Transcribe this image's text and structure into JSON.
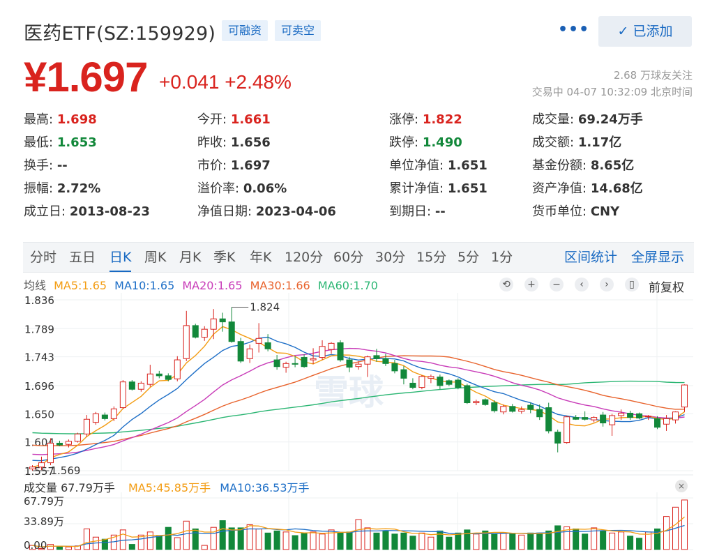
{
  "header": {
    "title": "医药ETF(SZ:159929)",
    "tag_margin": "可融资",
    "tag_short": "可卖空",
    "more": "•••",
    "added_label": "已添加",
    "price": "¥1.697",
    "change": "+0.041 +2.48%",
    "followers": "2.68 万球友关注",
    "status": "交易中 04-07 10:32:09 北京时间"
  },
  "stats": {
    "high_label": "最高:",
    "high": "1.698",
    "low_label": "最低:",
    "low": "1.653",
    "turnover_label": "换手:",
    "turnover": "--",
    "amplitude_label": "振幅:",
    "amplitude": "2.72%",
    "found_label": "成立日:",
    "found": "2013-08-23",
    "open_label": "今开:",
    "open": "1.661",
    "prev_label": "昨收:",
    "prev": "1.656",
    "mktprice_label": "市价:",
    "mktprice": "1.697",
    "premium_label": "溢价率:",
    "premium": "0.06%",
    "navdate_label": "净值日期:",
    "navdate": "2023-04-06",
    "limitup_label": "涨停:",
    "limitup": "1.822",
    "limitdown_label": "跌停:",
    "limitdown": "1.490",
    "unitnav_label": "单位净值:",
    "unitnav": "1.651",
    "cumnav_label": "累计净值:",
    "cumnav": "1.651",
    "expire_label": "到期日:",
    "expire": "--",
    "volume_label": "成交量:",
    "volume": "69.24万手",
    "amount_label": "成交额:",
    "amount": "1.17亿",
    "shares_label": "基金份额:",
    "shares": "8.65亿",
    "assets_label": "资产净值:",
    "assets": "14.68亿",
    "currency_label": "货币单位:",
    "currency": "CNY"
  },
  "tabs": [
    "分时",
    "五日",
    "日K",
    "周K",
    "月K",
    "季K",
    "年K",
    "120分",
    "60分",
    "30分",
    "15分",
    "5分",
    "1分"
  ],
  "tabs_active": 2,
  "tabs_right": [
    "区间统计",
    "全屏显示"
  ],
  "ma": {
    "avg": "均线",
    "ma5": "MA5:1.65",
    "ma10": "MA10:1.65",
    "ma20": "MA20:1.65",
    "ma30": "MA30:1.66",
    "ma60": "MA60:1.70",
    "fq": "前复权"
  },
  "controls": [
    "⟲",
    "+",
    "−",
    "‹",
    "›",
    "▯"
  ],
  "watermark": "雪球",
  "colors": {
    "up": "#d9231e",
    "down": "#12883a",
    "ma5": "#f39c12",
    "ma10": "#1e6fc7",
    "ma20": "#c83bb8",
    "ma30": "#e8622b",
    "ma60": "#2bb673",
    "accent": "#1869c2"
  },
  "volume": {
    "header": "成交量 67.79万手",
    "ma5": "MA5:45.85万手",
    "ma10": "MA10:36.53万手",
    "ticks": [
      "67.79万",
      "33.89万",
      "0.00"
    ],
    "close": "×"
  },
  "chart_data": {
    "type": "candlestick",
    "yticks": [
      "1.836",
      "1.789",
      "1.743",
      "1.696",
      "1.650",
      "1.604",
      "1.557"
    ],
    "ylim": [
      1.557,
      1.836
    ],
    "max_label": "1.824",
    "min_label": "1.569",
    "candles": [
      {
        "o": 1.56,
        "h": 1.566,
        "l": 1.557,
        "c": 1.563
      },
      {
        "o": 1.563,
        "h": 1.58,
        "l": 1.558,
        "c": 1.57
      },
      {
        "o": 1.57,
        "h": 1.61,
        "l": 1.566,
        "c": 1.602
      },
      {
        "o": 1.602,
        "h": 1.606,
        "l": 1.597,
        "c": 1.599
      },
      {
        "o": 1.6,
        "h": 1.608,
        "l": 1.595,
        "c": 1.605
      },
      {
        "o": 1.605,
        "h": 1.619,
        "l": 1.603,
        "c": 1.617
      },
      {
        "o": 1.617,
        "h": 1.648,
        "l": 1.612,
        "c": 1.641
      },
      {
        "o": 1.636,
        "h": 1.653,
        "l": 1.632,
        "c": 1.65
      },
      {
        "o": 1.648,
        "h": 1.652,
        "l": 1.639,
        "c": 1.642
      },
      {
        "o": 1.642,
        "h": 1.662,
        "l": 1.638,
        "c": 1.658
      },
      {
        "o": 1.66,
        "h": 1.705,
        "l": 1.658,
        "c": 1.702
      },
      {
        "o": 1.702,
        "h": 1.705,
        "l": 1.688,
        "c": 1.69
      },
      {
        "o": 1.69,
        "h": 1.703,
        "l": 1.686,
        "c": 1.7
      },
      {
        "o": 1.698,
        "h": 1.73,
        "l": 1.694,
        "c": 1.715
      },
      {
        "o": 1.715,
        "h": 1.72,
        "l": 1.708,
        "c": 1.712
      },
      {
        "o": 1.712,
        "h": 1.716,
        "l": 1.703,
        "c": 1.706
      },
      {
        "o": 1.707,
        "h": 1.744,
        "l": 1.703,
        "c": 1.738
      },
      {
        "o": 1.74,
        "h": 1.818,
        "l": 1.736,
        "c": 1.794
      },
      {
        "o": 1.794,
        "h": 1.797,
        "l": 1.773,
        "c": 1.775
      },
      {
        "o": 1.775,
        "h": 1.793,
        "l": 1.769,
        "c": 1.788
      },
      {
        "o": 1.788,
        "h": 1.821,
        "l": 1.772,
        "c": 1.805
      },
      {
        "o": 1.805,
        "h": 1.815,
        "l": 1.784,
        "c": 1.8
      },
      {
        "o": 1.8,
        "h": 1.824,
        "l": 1.766,
        "c": 1.768
      },
      {
        "o": 1.768,
        "h": 1.774,
        "l": 1.733,
        "c": 1.736
      },
      {
        "o": 1.74,
        "h": 1.763,
        "l": 1.733,
        "c": 1.756
      },
      {
        "o": 1.765,
        "h": 1.798,
        "l": 1.75,
        "c": 1.773
      },
      {
        "o": 1.766,
        "h": 1.78,
        "l": 1.752,
        "c": 1.756
      },
      {
        "o": 1.738,
        "h": 1.746,
        "l": 1.722,
        "c": 1.727
      },
      {
        "o": 1.726,
        "h": 1.735,
        "l": 1.717,
        "c": 1.732
      },
      {
        "o": 1.732,
        "h": 1.744,
        "l": 1.726,
        "c": 1.731
      },
      {
        "o": 1.742,
        "h": 1.747,
        "l": 1.725,
        "c": 1.727
      },
      {
        "o": 1.738,
        "h": 1.757,
        "l": 1.731,
        "c": 1.74
      },
      {
        "o": 1.742,
        "h": 1.77,
        "l": 1.738,
        "c": 1.76
      },
      {
        "o": 1.755,
        "h": 1.767,
        "l": 1.748,
        "c": 1.765
      },
      {
        "o": 1.766,
        "h": 1.77,
        "l": 1.735,
        "c": 1.738
      },
      {
        "o": 1.738,
        "h": 1.743,
        "l": 1.718,
        "c": 1.726
      },
      {
        "o": 1.727,
        "h": 1.736,
        "l": 1.722,
        "c": 1.731
      },
      {
        "o": 1.731,
        "h": 1.745,
        "l": 1.71,
        "c": 1.743
      },
      {
        "o": 1.745,
        "h": 1.756,
        "l": 1.735,
        "c": 1.74
      },
      {
        "o": 1.74,
        "h": 1.748,
        "l": 1.728,
        "c": 1.732
      },
      {
        "o": 1.732,
        "h": 1.738,
        "l": 1.716,
        "c": 1.72
      },
      {
        "o": 1.722,
        "h": 1.728,
        "l": 1.698,
        "c": 1.708
      },
      {
        "o": 1.7,
        "h": 1.708,
        "l": 1.69,
        "c": 1.693
      },
      {
        "o": 1.693,
        "h": 1.713,
        "l": 1.69,
        "c": 1.711
      },
      {
        "o": 1.708,
        "h": 1.714,
        "l": 1.7,
        "c": 1.711
      },
      {
        "o": 1.71,
        "h": 1.714,
        "l": 1.69,
        "c": 1.696
      },
      {
        "o": 1.704,
        "h": 1.706,
        "l": 1.695,
        "c": 1.698
      },
      {
        "o": 1.705,
        "h": 1.708,
        "l": 1.69,
        "c": 1.693
      },
      {
        "o": 1.696,
        "h": 1.699,
        "l": 1.666,
        "c": 1.668
      },
      {
        "o": 1.668,
        "h": 1.673,
        "l": 1.664,
        "c": 1.67
      },
      {
        "o": 1.673,
        "h": 1.675,
        "l": 1.663,
        "c": 1.665
      },
      {
        "o": 1.668,
        "h": 1.672,
        "l": 1.652,
        "c": 1.655
      },
      {
        "o": 1.653,
        "h": 1.665,
        "l": 1.649,
        "c": 1.662
      },
      {
        "o": 1.662,
        "h": 1.666,
        "l": 1.652,
        "c": 1.654
      },
      {
        "o": 1.654,
        "h": 1.662,
        "l": 1.65,
        "c": 1.657
      },
      {
        "o": 1.664,
        "h": 1.668,
        "l": 1.651,
        "c": 1.657
      },
      {
        "o": 1.657,
        "h": 1.665,
        "l": 1.64,
        "c": 1.645
      },
      {
        "o": 1.66,
        "h": 1.668,
        "l": 1.618,
        "c": 1.622
      },
      {
        "o": 1.62,
        "h": 1.624,
        "l": 1.587,
        "c": 1.602
      },
      {
        "o": 1.603,
        "h": 1.647,
        "l": 1.601,
        "c": 1.645
      },
      {
        "o": 1.644,
        "h": 1.648,
        "l": 1.64,
        "c": 1.641
      },
      {
        "o": 1.644,
        "h": 1.654,
        "l": 1.639,
        "c": 1.641
      },
      {
        "o": 1.64,
        "h": 1.646,
        "l": 1.636,
        "c": 1.644
      },
      {
        "o": 1.648,
        "h": 1.653,
        "l": 1.629,
        "c": 1.635
      },
      {
        "o": 1.632,
        "h": 1.65,
        "l": 1.614,
        "c": 1.647
      },
      {
        "o": 1.647,
        "h": 1.657,
        "l": 1.64,
        "c": 1.651
      },
      {
        "o": 1.651,
        "h": 1.655,
        "l": 1.64,
        "c": 1.644
      },
      {
        "o": 1.65,
        "h": 1.652,
        "l": 1.641,
        "c": 1.643
      },
      {
        "o": 1.645,
        "h": 1.648,
        "l": 1.64,
        "c": 1.646
      },
      {
        "o": 1.642,
        "h": 1.646,
        "l": 1.625,
        "c": 1.628
      },
      {
        "o": 1.633,
        "h": 1.648,
        "l": 1.622,
        "c": 1.642
      },
      {
        "o": 1.64,
        "h": 1.654,
        "l": 1.634,
        "c": 1.653
      },
      {
        "o": 1.661,
        "h": 1.698,
        "l": 1.653,
        "c": 1.697
      }
    ],
    "volumes": [
      0.08,
      0.02,
      0.1,
      0.06,
      0.05,
      0.07,
      0.4,
      0.24,
      0.2,
      0.28,
      0.38,
      0.1,
      0.28,
      0.34,
      0.26,
      0.43,
      0.23,
      0.55,
      0.4,
      0.08,
      0.43,
      0.56,
      0.42,
      0.42,
      0.48,
      0.4,
      0.32,
      0.36,
      0.34,
      0.27,
      0.32,
      0.34,
      0.3,
      0.38,
      0.32,
      0.34,
      0.58,
      0.42,
      0.32,
      0.36,
      0.3,
      0.32,
      0.26,
      0.32,
      0.24,
      0.36,
      0.24,
      0.32,
      0.38,
      0.3,
      0.36,
      0.3,
      0.32,
      0.3,
      0.28,
      0.32,
      0.32,
      0.36,
      0.46,
      0.44,
      0.4,
      0.3,
      0.42,
      0.36,
      0.32,
      0.34,
      0.26,
      0.22,
      0.34,
      0.4,
      0.64,
      0.82,
      0.96
    ]
  }
}
